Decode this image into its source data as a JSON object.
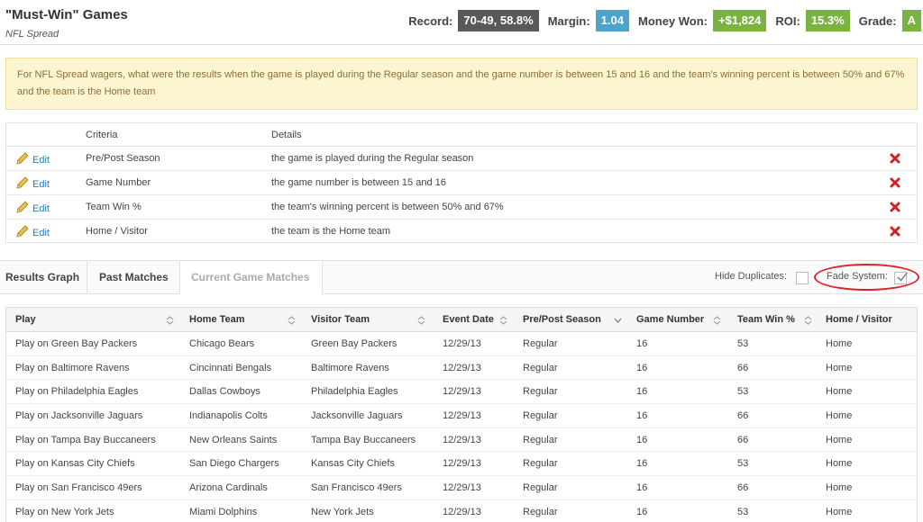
{
  "header": {
    "title": "\"Must-Win\" Games",
    "subtitle": "NFL Spread",
    "stats": [
      {
        "label": "Record:",
        "value": "70-49, 58.8%",
        "color": "#595959"
      },
      {
        "label": "Margin:",
        "value": "1.04",
        "color": "#4da3cc"
      },
      {
        "label": "Money Won:",
        "value": "+$1,824",
        "color": "#79b340"
      },
      {
        "label": "ROI:",
        "value": "15.3%",
        "color": "#79b340"
      },
      {
        "label": "Grade:",
        "value": "A",
        "color": "#79b340"
      }
    ]
  },
  "description": "For NFL Spread wagers, what were the results when the game is played during the Regular season and the game number is between 15 and 16 and the team's winning percent is between 50% and 67% and the team is the Home team",
  "criteria": {
    "headers": {
      "criteria": "Criteria",
      "details": "Details"
    },
    "edit_label": "Edit",
    "rows": [
      {
        "criteria": "Pre/Post Season",
        "details": "the game is played during the Regular season"
      },
      {
        "criteria": "Game Number",
        "details": "the game number is between 15 and 16"
      },
      {
        "criteria": "Team Win %",
        "details": "the team's winning percent is between 50% and 67%"
      },
      {
        "criteria": "Home / Visitor",
        "details": "the team is the Home team"
      }
    ]
  },
  "tabs": {
    "results_graph": "Results Graph",
    "past_matches": "Past Matches",
    "current_game_matches": "Current Game Matches",
    "hide_duplicates_label": "Hide Duplicates:",
    "fade_system_label": "Fade System:",
    "hide_duplicates_checked": false,
    "fade_system_checked": true
  },
  "results": {
    "headers": [
      "Play",
      "Home Team",
      "Visitor Team",
      "Event Date",
      "Pre/Post Season",
      "Game Number",
      "Team Win %",
      "Home / Visitor"
    ],
    "rows": [
      [
        "Play on Green Bay Packers",
        "Chicago Bears",
        "Green Bay Packers",
        "12/29/13",
        "Regular",
        "16",
        "53",
        "Home"
      ],
      [
        "Play on Baltimore Ravens",
        "Cincinnati Bengals",
        "Baltimore Ravens",
        "12/29/13",
        "Regular",
        "16",
        "66",
        "Home"
      ],
      [
        "Play on Philadelphia Eagles",
        "Dallas Cowboys",
        "Philadelphia Eagles",
        "12/29/13",
        "Regular",
        "16",
        "53",
        "Home"
      ],
      [
        "Play on Jacksonville Jaguars",
        "Indianapolis Colts",
        "Jacksonville Jaguars",
        "12/29/13",
        "Regular",
        "16",
        "66",
        "Home"
      ],
      [
        "Play on Tampa Bay Buccaneers",
        "New Orleans Saints",
        "Tampa Bay Buccaneers",
        "12/29/13",
        "Regular",
        "16",
        "66",
        "Home"
      ],
      [
        "Play on Kansas City Chiefs",
        "San Diego Chargers",
        "Kansas City Chiefs",
        "12/29/13",
        "Regular",
        "16",
        "53",
        "Home"
      ],
      [
        "Play on San Francisco 49ers",
        "Arizona Cardinals",
        "San Francisco 49ers",
        "12/29/13",
        "Regular",
        "16",
        "66",
        "Home"
      ],
      [
        "Play on New York Jets",
        "Miami Dolphins",
        "New York Jets",
        "12/29/13",
        "Regular",
        "16",
        "53",
        "Home"
      ]
    ]
  }
}
